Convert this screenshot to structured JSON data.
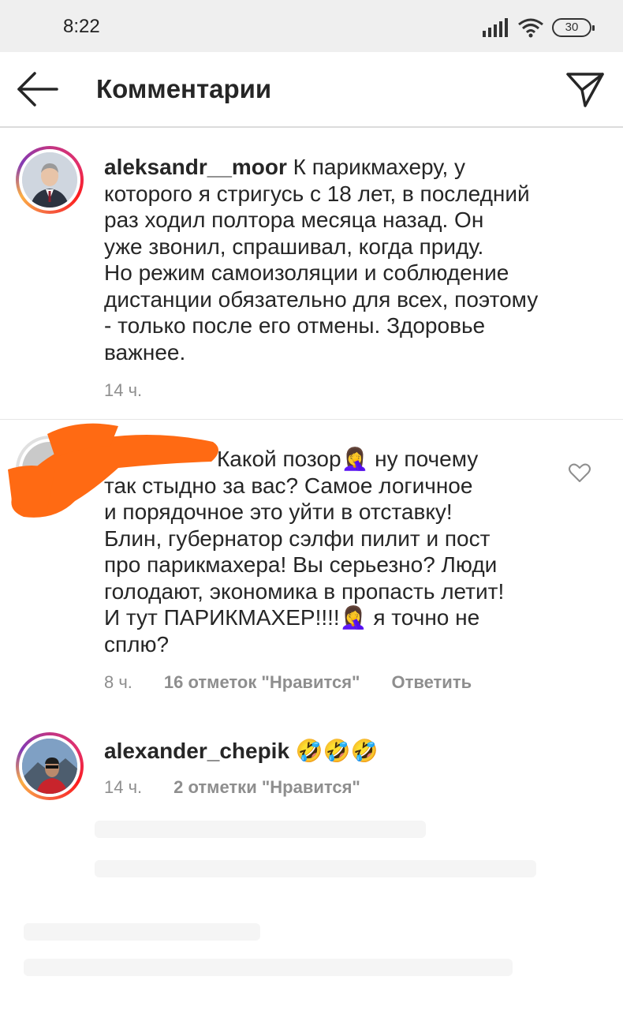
{
  "status_bar": {
    "time": "8:22",
    "battery": "30"
  },
  "header": {
    "title": "Комментарии",
    "icons": [
      "back-arrow-icon",
      "direct-send-icon"
    ]
  },
  "comments": [
    {
      "username": "aleksandr__moor",
      "lines": [
        "К парикмахеру, у",
        "которого я стригусь с 18 лет, в последний",
        "раз ходил полтора месяца назад. Он",
        "уже звонил, спрашивал, когда приду.",
        "Но режим самоизоляции и соблюдение",
        "дистанции обязательно для всех, поэтому",
        "- только после его отмены. Здоровье",
        "важнее."
      ],
      "time": "14 ч."
    },
    {
      "lines": [
        "Какой позор🤦‍♀️ ну почему",
        "так стыдно за вас? Самое логичное",
        "и порядочное это уйти в отставку!",
        "Блин, губернатор сэлфи пилит и пост",
        "про парикмахера! Вы серьезно? Люди",
        "голодают, экономика в пропасть летит!",
        "И тут ПАРИКМАХЕР!!!!🤦‍♀️ я точно не",
        "сплю?"
      ],
      "time": "8 ч.",
      "likes": "16 отметок \"Нравится\"",
      "reply": "Ответить"
    },
    {
      "username": "alexander_chepik",
      "text": "🤣🤣🤣",
      "time": "14 ч.",
      "likes": "2 отметки \"Нравится\""
    }
  ]
}
